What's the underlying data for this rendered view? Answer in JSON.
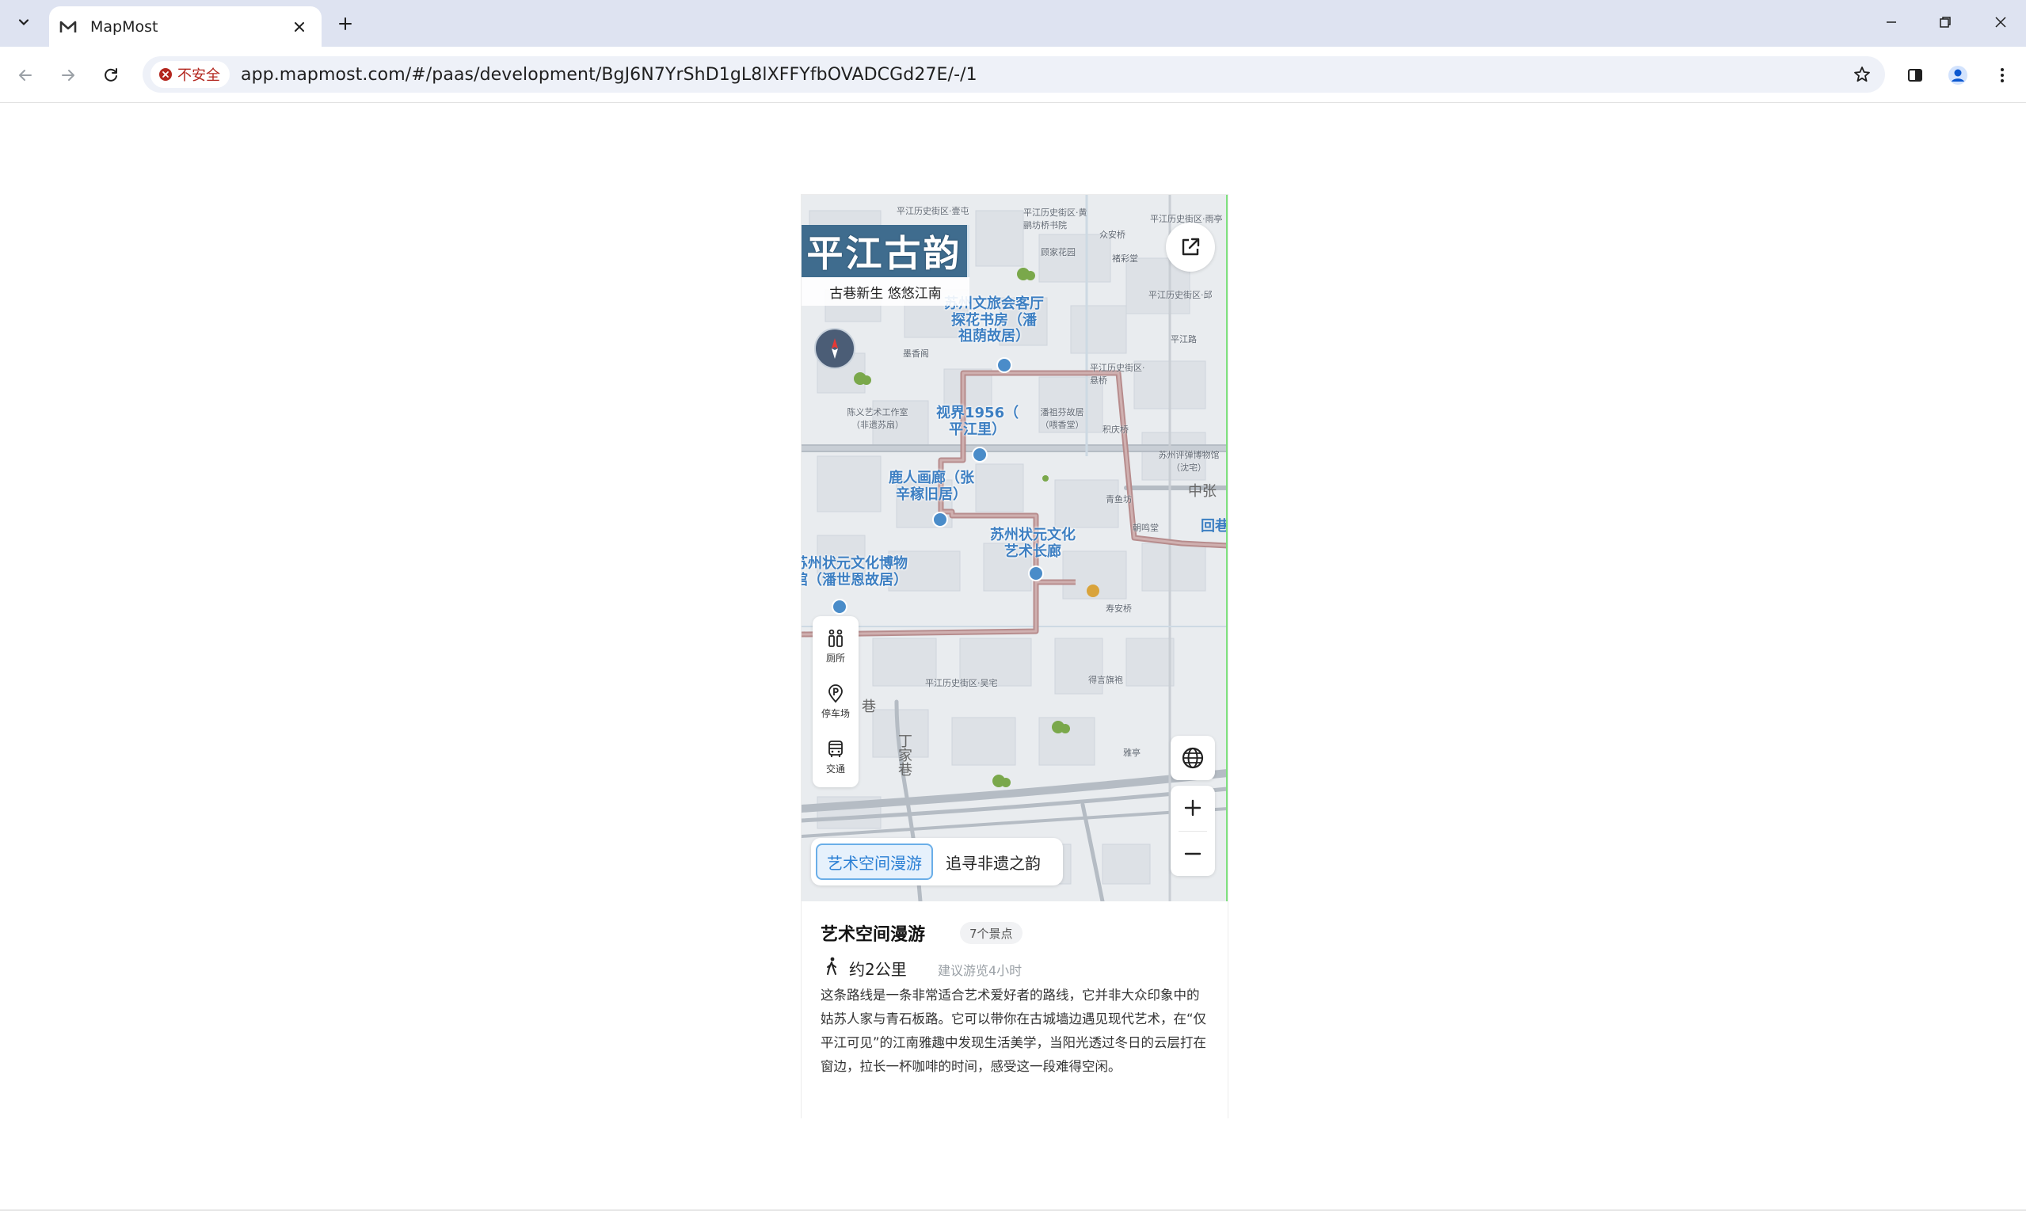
{
  "browser": {
    "tab_title": "MapMost",
    "security_label": "不安全",
    "url": "app.mapmost.com/#/paas/development/BgJ6N7YrShD1gL8lXFFYfbOVADCGd27E/-/1"
  },
  "map": {
    "brand_title": "平江古韵",
    "brand_subtitle": "古巷新生 悠悠江南",
    "poi_buttons": [
      {
        "label": "厕所",
        "icon": "restroom-icon"
      },
      {
        "label": "停车场",
        "icon": "parking-icon"
      },
      {
        "label": "交通",
        "icon": "bus-icon"
      }
    ],
    "route_tabs": [
      {
        "label": "艺术空间漫游",
        "active": true
      },
      {
        "label": "追寻非遗之韵",
        "active": false
      }
    ],
    "labels": [
      {
        "text": "苏州文旅会客厅\n探花书房（潘\n祖荫故居）"
      },
      {
        "text": "视界1956（\n平江里）"
      },
      {
        "text": "鹿人画廊（张\n辛稼旧居）"
      },
      {
        "text": "苏州状元文化博物\n馆（潘世恩故居）"
      },
      {
        "text": "苏州状元文化\n艺术长廊"
      }
    ],
    "small_labels": [
      "平江历史街区·壹屯",
      "平江历史街区·黄鹂坊桥书院",
      "众安桥",
      "顾家花园",
      "褚彩堂",
      "平江历史街区·雨亭",
      "平江历史街区·邱",
      "平江路",
      "墨香阁",
      "平江历史街区·悬桥",
      "陈义艺术工作室（非遗苏扇）",
      "潘祖芬故居（喂香堂）",
      "积庆桥",
      "苏州评弹博物馆（沈宅）",
      "青鱼坊",
      "朝鸣堂",
      "寿安桥",
      "平江历史街区·吴宅",
      "得言旗袍",
      "雅亭"
    ],
    "roads": [
      "中张",
      "回巷",
      "巷",
      "丁家巷"
    ]
  },
  "info": {
    "title": "艺术空间漫游",
    "badge": "7个景点",
    "distance": "约2公里",
    "suggest": "建议游览4小时",
    "description": "这条路线是一条非常适合艺术爱好者的路线，它并非大众印象中的姑苏人家与青石板路。它可以带你在古城墙边遇见现代艺术，在“仅平江可见”的江南雅趣中发现生活美学，当阳光透过冬日的云层打在窗边，拉长一杯咖啡的时间，感受这一段难得空闲。"
  },
  "colors": {
    "brand_bg": "#3f6c8e",
    "route_line": "#b78c8c",
    "active_tab": "#2a7fd4",
    "label_blue": "#3d7fc2"
  }
}
